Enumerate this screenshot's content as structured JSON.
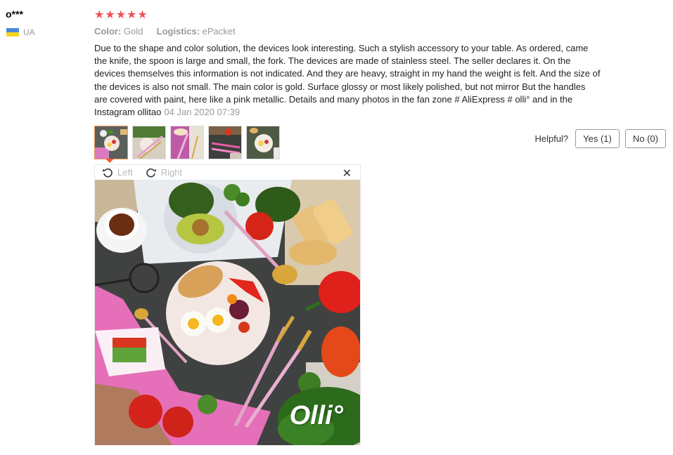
{
  "review": {
    "user": "o***",
    "country": "UA",
    "stars": [
      "★",
      "★",
      "★",
      "★",
      "★"
    ],
    "color_label": "Color:",
    "color_value": "Gold",
    "logistics_label": "Logistics:",
    "logistics_value": "ePacket",
    "text": "Due to the shape and color solution, the devices look interesting. Such a stylish accessory to your table. As ordered, came the knife, the spoon is large and small, the fork. The devices are made of stainless steel. The seller declares it. On the devices themselves this information is not indicated. And they are heavy, straight in my hand the weight is felt. And the size of the devices is also not small. The main color is gold. Surface glossy or most likely polished, but not mirror But the handles are covered with paint, here like a pink metallic. Details and many photos in the fan zone # AliExpress # olli° and in the Instagram ollitao",
    "date": "04 Jan 2020 07:39"
  },
  "helpful": {
    "label": "Helpful?",
    "yes": "Yes (1)",
    "no": "No (0)"
  },
  "viewer": {
    "rotate_left": "Left",
    "rotate_right": "Right",
    "close": "✕",
    "watermark": "Olli°"
  },
  "thumbnails": [
    {
      "name": "photo-1",
      "active": true
    },
    {
      "name": "photo-2",
      "active": false
    },
    {
      "name": "photo-3",
      "active": false
    },
    {
      "name": "photo-4",
      "active": false
    },
    {
      "name": "photo-5",
      "active": false
    }
  ],
  "colors": {
    "star": "#f04f56",
    "active_border": "#f08f52",
    "muted": "#999999"
  }
}
